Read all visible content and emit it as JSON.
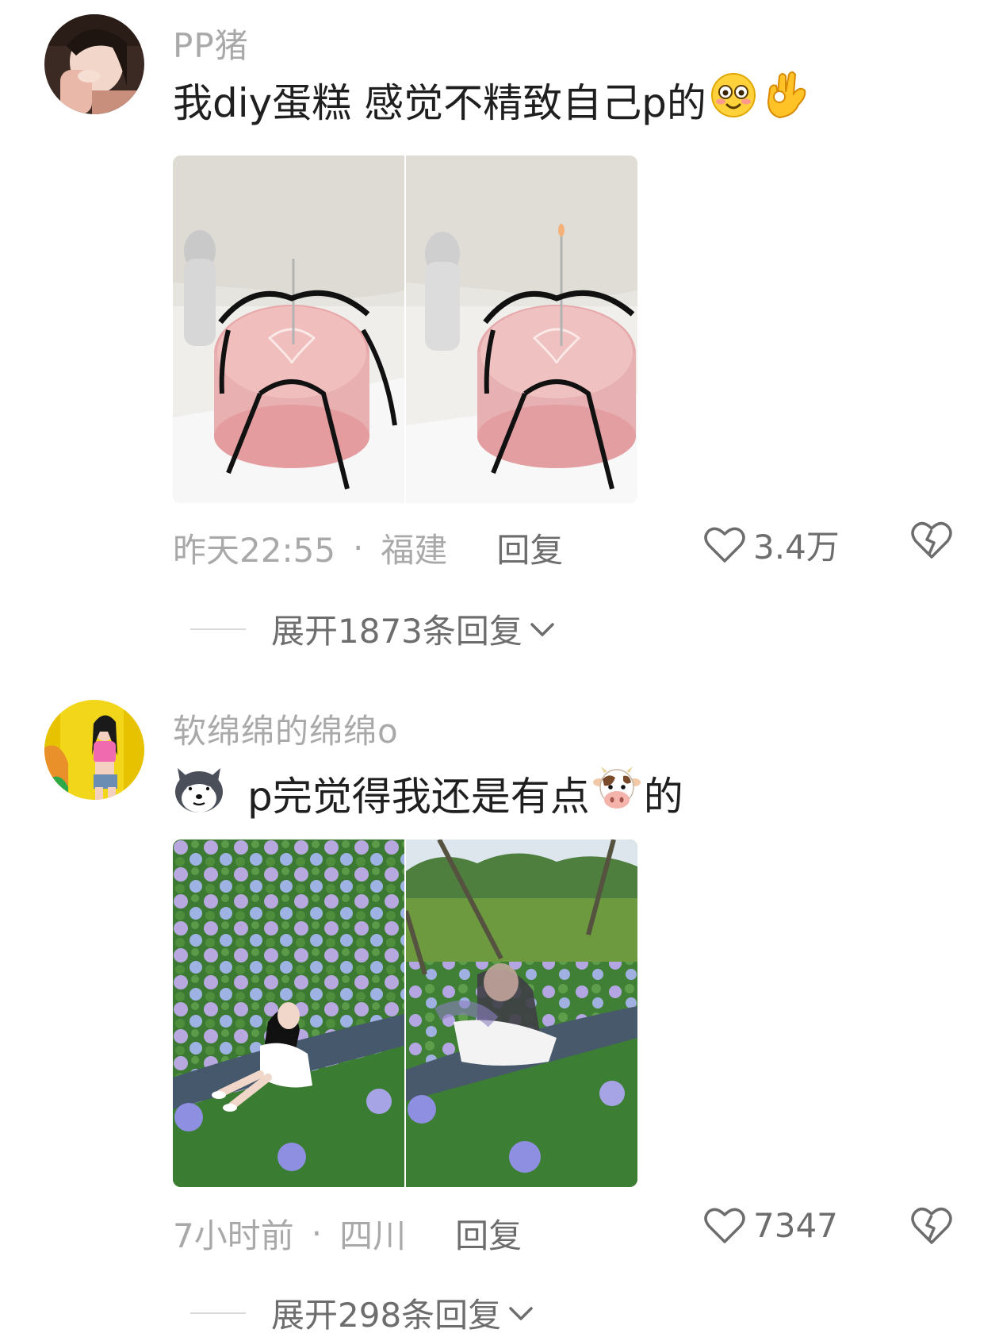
{
  "comments": [
    {
      "username": "PP猪",
      "text": "我diy蛋糕 感觉不精致自己p的",
      "emojis": [
        "blush-smile-emoji",
        "ok-hand-emoji"
      ],
      "images": [
        "cake-original-photo",
        "cake-edited-photo"
      ],
      "time": "昨天22:55",
      "location": "福建",
      "reply_label": "回复",
      "like_count": "3.4万",
      "expand_label": "展开1873条回复"
    },
    {
      "username": "软绵绵的绵绵o",
      "text": "p完觉得我还是有点",
      "text_suffix": "的",
      "emojis": [
        "dog-emoji",
        "cow-emoji"
      ],
      "images": [
        "hydrangea-edited-photo",
        "hydrangea-original-photo"
      ],
      "time": "7小时前",
      "location": "四川",
      "reply_label": "回复",
      "like_count": "7347",
      "expand_label": "展开298条回复"
    }
  ],
  "separator": "·",
  "colors": {
    "meta_gray": "#a9a9a9",
    "action_gray": "#6d6d6d",
    "text": "#1f1f1f"
  }
}
